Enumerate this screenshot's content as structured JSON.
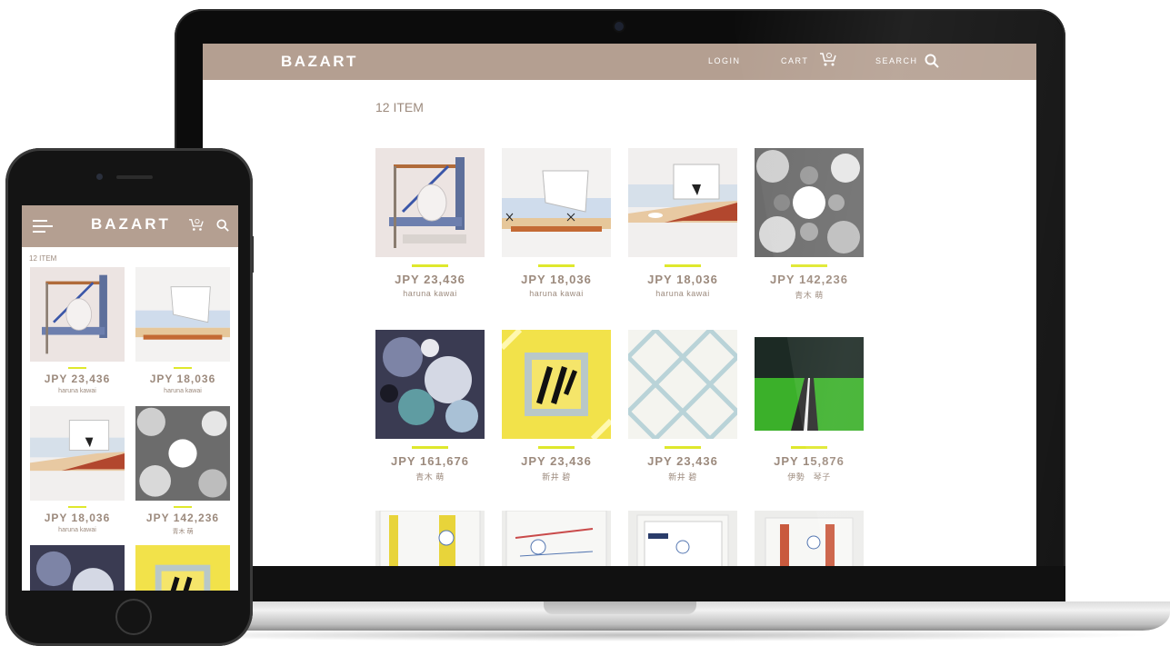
{
  "brand": "BAZART",
  "laptop": {
    "nav": {
      "login": "LOGIN",
      "cart": "CART",
      "search": "SEARCH"
    },
    "item_count": "12 ITEM",
    "items": [
      {
        "price": "JPY 23,436",
        "artist": "haruna kawai"
      },
      {
        "price": "JPY 18,036",
        "artist": "haruna kawai"
      },
      {
        "price": "JPY 18,036",
        "artist": "haruna kawai"
      },
      {
        "price": "JPY 142,236",
        "artist": "青木 萌"
      },
      {
        "price": "JPY 161,676",
        "artist": "青木 萌"
      },
      {
        "price": "JPY 23,436",
        "artist": "新井 碧"
      },
      {
        "price": "JPY 23,436",
        "artist": "新井 碧"
      },
      {
        "price": "JPY 15,876",
        "artist": "伊勢　琴子"
      }
    ]
  },
  "phone": {
    "item_count": "12 ITEM",
    "items": [
      {
        "price": "JPY 23,436",
        "artist": "haruna kawai"
      },
      {
        "price": "JPY 18,036",
        "artist": "haruna kawai"
      },
      {
        "price": "JPY 18,036",
        "artist": "haruna kawai"
      },
      {
        "price": "JPY 142,236",
        "artist": "青木 萌"
      }
    ]
  },
  "colors": {
    "header": "#b49f91",
    "text": "#9c8a7d",
    "accent": "#dfe82c"
  }
}
